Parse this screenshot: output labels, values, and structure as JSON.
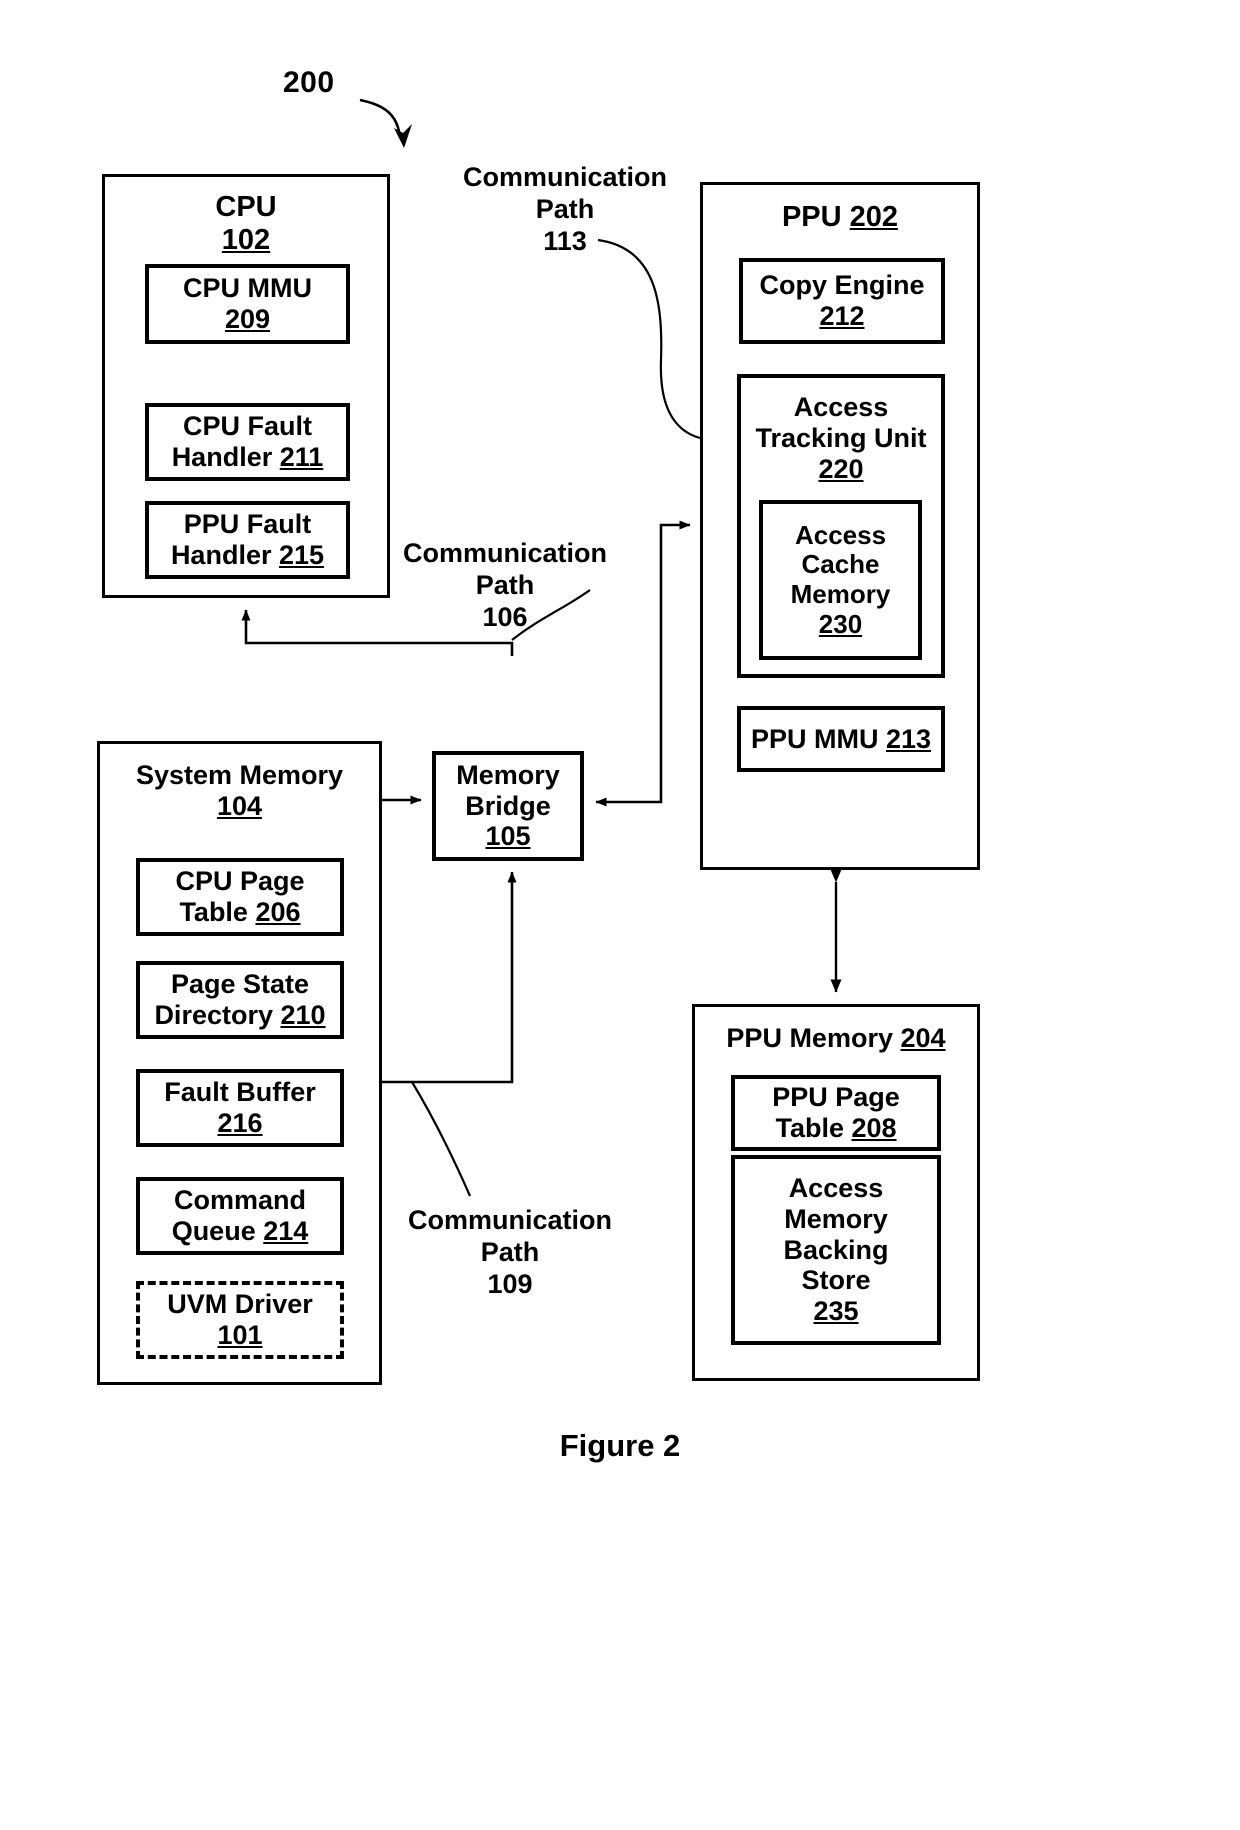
{
  "figure": {
    "ref_number": "200",
    "caption": "Figure 2"
  },
  "blocks": {
    "cpu": {
      "title": "CPU",
      "number": "102",
      "children": [
        {
          "title": "CPU MMU",
          "number": "209",
          "number_inline": false
        },
        {
          "title": "CPU Fault",
          "number": "211",
          "number_inline": true,
          "second_line": "Handler"
        },
        {
          "title": "PPU Fault",
          "number": "215",
          "number_inline": true,
          "second_line": "Handler"
        }
      ]
    },
    "ppu": {
      "title": "PPU",
      "number": "202",
      "children": [
        {
          "title": "Copy Engine",
          "number": "212"
        },
        {
          "title": "Access\nTracking Unit",
          "number": "220"
        },
        {
          "title": "Access\nCache\nMemory",
          "number": "230"
        },
        {
          "title": "PPU MMU",
          "number": "213"
        }
      ]
    },
    "system_memory": {
      "title": "System Memory",
      "number": "104",
      "children": [
        {
          "line1": "CPU Page",
          "line2": "Table",
          "number": "206"
        },
        {
          "line1": "Page State",
          "line2": "Directory",
          "number": "210"
        },
        {
          "line1": "Fault Buffer",
          "number": "216"
        },
        {
          "line1": "Command",
          "line2": "Queue",
          "number": "214"
        },
        {
          "line1": "UVM Driver",
          "number": "101",
          "dashed": true
        }
      ]
    },
    "memory_bridge": {
      "title": "Memory\nBridge",
      "number": "105"
    },
    "ppu_memory": {
      "title": "PPU Memory",
      "number": "204",
      "children": [
        {
          "line1": "PPU Page",
          "line2": "Table",
          "number": "208"
        },
        {
          "line1": "Access\nMemory\nBacking\nStore",
          "number": "235"
        }
      ]
    }
  },
  "labels": {
    "path_113": "Communication\nPath\n113",
    "path_106": "Communication\nPath\n106",
    "path_109": "Communication\nPath\n109"
  },
  "colors": {
    "stroke": "#000000",
    "background": "#ffffff"
  }
}
